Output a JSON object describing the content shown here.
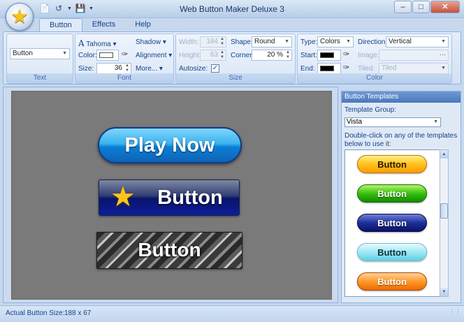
{
  "window": {
    "title": "Web Button Maker Deluxe 3",
    "controls": {
      "minimize": "–",
      "maximize": "□",
      "close": "✕"
    }
  },
  "quick_access": [
    "new-file-icon",
    "undo-icon",
    "save-icon"
  ],
  "tabs": [
    {
      "label": "Button",
      "active": true
    },
    {
      "label": "Effects",
      "active": false
    },
    {
      "label": "Help",
      "active": false
    }
  ],
  "ribbon": {
    "text": {
      "group_label": "Text",
      "value": "Button"
    },
    "font": {
      "group_label": "Font",
      "family": "Tahoma",
      "color_label": "Color:",
      "color_value": "#ffffff",
      "size_label": "Size:",
      "size_value": "36",
      "shadow_label": "Shadow",
      "alignment_label": "Alignment",
      "more_label": "More..."
    },
    "size": {
      "group_label": "Size",
      "width_label": "Width:",
      "width_value": "184",
      "height_label": "Height:",
      "height_value": "63",
      "autosize_label": "Autosize:",
      "autosize_checked": true,
      "shape_label": "Shape:",
      "shape_value": "Round",
      "corner_label": "Corner:",
      "corner_value": "20 %"
    },
    "color": {
      "group_label": "Color",
      "type_label": "Type:",
      "type_value": "Colors",
      "start_label": "Start:",
      "start_color": "#000000",
      "end_label": "End:",
      "end_color": "#000000",
      "direction_label": "Direction:",
      "direction_value": "Vertical",
      "image_label": "Image:",
      "image_value": "",
      "tiled_label": "Tiled:",
      "tiled_value": "Tiled"
    }
  },
  "canvas": {
    "buttons": [
      {
        "label": "Play Now",
        "style": "blue-pill"
      },
      {
        "label": "Button",
        "style": "navy-with-star",
        "icon": "star-icon"
      },
      {
        "label": "Button",
        "style": "marble"
      }
    ]
  },
  "templates_panel": {
    "title": "Button Templates",
    "group_label": "Template Group:",
    "group_value": "Vista",
    "description": "Double-click on any of the templates below to use it:",
    "templates": [
      {
        "label": "Button",
        "color": "#ffc21c"
      },
      {
        "label": "Button",
        "color": "#38c00f"
      },
      {
        "label": "Button",
        "color": "#1f2f9a"
      },
      {
        "label": "Button",
        "color": "#9fe8f5"
      },
      {
        "label": "Button",
        "color": "#ff9a2a"
      }
    ]
  },
  "status_bar": {
    "label": "Actual Button Size:",
    "value": "188 x 67"
  }
}
